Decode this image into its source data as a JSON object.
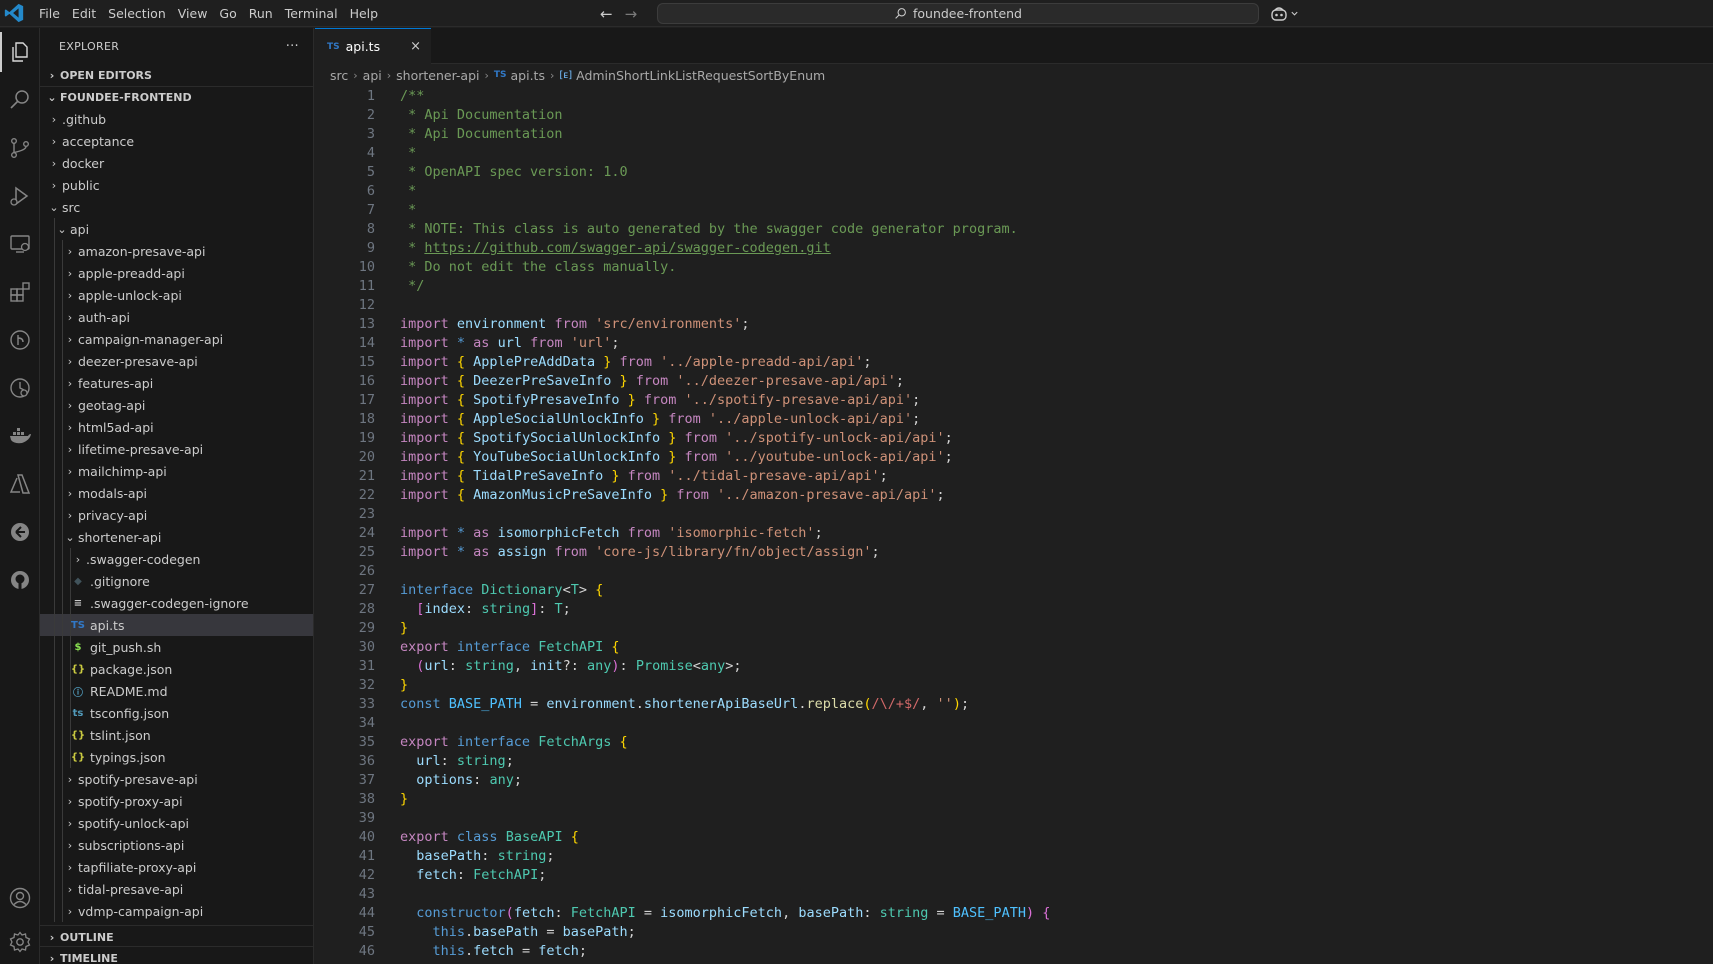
{
  "titlebar": {
    "menu": [
      "File",
      "Edit",
      "Selection",
      "View",
      "Go",
      "Run",
      "Terminal",
      "Help"
    ],
    "search": "foundee-frontend"
  },
  "sidebar": {
    "title": "EXPLORER",
    "more": "···",
    "open_editors": "OPEN EDITORS",
    "project": "FOUNDEE-FRONTEND",
    "outline": "OUTLINE",
    "timeline": "TIMELINE",
    "tree": [
      {
        "label": ".github",
        "depth": 1,
        "kind": "folder",
        "open": false
      },
      {
        "label": "acceptance",
        "depth": 1,
        "kind": "folder",
        "open": false
      },
      {
        "label": "docker",
        "depth": 1,
        "kind": "folder",
        "open": false
      },
      {
        "label": "public",
        "depth": 1,
        "kind": "folder",
        "open": false
      },
      {
        "label": "src",
        "depth": 1,
        "kind": "folder",
        "open": true
      },
      {
        "label": "api",
        "depth": 2,
        "kind": "folder",
        "open": true
      },
      {
        "label": "amazon-presave-api",
        "depth": 3,
        "kind": "folder",
        "open": false
      },
      {
        "label": "apple-preadd-api",
        "depth": 3,
        "kind": "folder",
        "open": false
      },
      {
        "label": "apple-unlock-api",
        "depth": 3,
        "kind": "folder",
        "open": false
      },
      {
        "label": "auth-api",
        "depth": 3,
        "kind": "folder",
        "open": false
      },
      {
        "label": "campaign-manager-api",
        "depth": 3,
        "kind": "folder",
        "open": false
      },
      {
        "label": "deezer-presave-api",
        "depth": 3,
        "kind": "folder",
        "open": false
      },
      {
        "label": "features-api",
        "depth": 3,
        "kind": "folder",
        "open": false
      },
      {
        "label": "geotag-api",
        "depth": 3,
        "kind": "folder",
        "open": false
      },
      {
        "label": "html5ad-api",
        "depth": 3,
        "kind": "folder",
        "open": false
      },
      {
        "label": "lifetime-presave-api",
        "depth": 3,
        "kind": "folder",
        "open": false
      },
      {
        "label": "mailchimp-api",
        "depth": 3,
        "kind": "folder",
        "open": false
      },
      {
        "label": "modals-api",
        "depth": 3,
        "kind": "folder",
        "open": false
      },
      {
        "label": "privacy-api",
        "depth": 3,
        "kind": "folder",
        "open": false
      },
      {
        "label": "shortener-api",
        "depth": 3,
        "kind": "folder",
        "open": true
      },
      {
        "label": ".swagger-codegen",
        "depth": 4,
        "kind": "folder",
        "open": false
      },
      {
        "label": ".gitignore",
        "depth": 4,
        "kind": "file",
        "icon": "◆",
        "color": "#41535b"
      },
      {
        "label": ".swagger-codegen-ignore",
        "depth": 4,
        "kind": "file",
        "icon": "≡",
        "color": "#cccccc"
      },
      {
        "label": "api.ts",
        "depth": 4,
        "kind": "file",
        "icon": "TS",
        "color": "#3178c6",
        "selected": true
      },
      {
        "label": "git_push.sh",
        "depth": 4,
        "kind": "file",
        "icon": "$",
        "color": "#89e051"
      },
      {
        "label": "package.json",
        "depth": 4,
        "kind": "file",
        "icon": "{}",
        "color": "#cbcb41"
      },
      {
        "label": "README.md",
        "depth": 4,
        "kind": "file",
        "icon": "ⓘ",
        "color": "#519aba"
      },
      {
        "label": "tsconfig.json",
        "depth": 4,
        "kind": "file",
        "icon": "ts",
        "color": "#519aba"
      },
      {
        "label": "tslint.json",
        "depth": 4,
        "kind": "file",
        "icon": "{}",
        "color": "#cbcb41"
      },
      {
        "label": "typings.json",
        "depth": 4,
        "kind": "file",
        "icon": "{}",
        "color": "#cbcb41"
      },
      {
        "label": "spotify-presave-api",
        "depth": 3,
        "kind": "folder",
        "open": false
      },
      {
        "label": "spotify-proxy-api",
        "depth": 3,
        "kind": "folder",
        "open": false
      },
      {
        "label": "spotify-unlock-api",
        "depth": 3,
        "kind": "folder",
        "open": false
      },
      {
        "label": "subscriptions-api",
        "depth": 3,
        "kind": "folder",
        "open": false
      },
      {
        "label": "tapfiliate-proxy-api",
        "depth": 3,
        "kind": "folder",
        "open": false
      },
      {
        "label": "tidal-presave-api",
        "depth": 3,
        "kind": "folder",
        "open": false
      },
      {
        "label": "vdmp-campaign-api",
        "depth": 3,
        "kind": "folder",
        "open": false
      }
    ]
  },
  "editor": {
    "tab": {
      "lang": "TS",
      "label": "api.ts",
      "close": "×"
    },
    "breadcrumb": [
      "src",
      "api",
      "shortener-api",
      "api.ts",
      "AdminShortLinkListRequestSortByEnum"
    ],
    "breadcrumb_ts": "TS",
    "breadcrumb_symbol_icon": "[ᴇ]",
    "lines": [
      [
        [
          "cm",
          "/**"
        ]
      ],
      [
        [
          "cm",
          " * Api Documentation"
        ]
      ],
      [
        [
          "cm",
          " * Api Documentation"
        ]
      ],
      [
        [
          "cm",
          " *"
        ]
      ],
      [
        [
          "cm",
          " * OpenAPI spec version: 1.0"
        ]
      ],
      [
        [
          "cm",
          " *"
        ]
      ],
      [
        [
          "cm",
          " *"
        ]
      ],
      [
        [
          "cm",
          " * NOTE: This class is auto generated by the swagger code generator program."
        ]
      ],
      [
        [
          "cm",
          " * "
        ],
        [
          "ln-link",
          "https://github.com/swagger-api/swagger-codegen.git"
        ]
      ],
      [
        [
          "cm",
          " * Do not edit the class manually."
        ]
      ],
      [
        [
          "cm",
          " */"
        ]
      ],
      [],
      [
        [
          "kw",
          "import "
        ],
        [
          "vr",
          "environment"
        ],
        [
          "kw",
          " from "
        ],
        [
          "st",
          "'src/environments'"
        ],
        [
          "op",
          ";"
        ]
      ],
      [
        [
          "kw",
          "import "
        ],
        [
          "kb",
          "*"
        ],
        [
          "kw",
          " as "
        ],
        [
          "vr",
          "url"
        ],
        [
          "kw",
          " from "
        ],
        [
          "st",
          "'url'"
        ],
        [
          "op",
          ";"
        ]
      ],
      [
        [
          "kw",
          "import "
        ],
        [
          "b1",
          "{ "
        ],
        [
          "vr",
          "ApplePreAddData"
        ],
        [
          "b1",
          " }"
        ],
        [
          "kw",
          " from "
        ],
        [
          "st",
          "'../apple-preadd-api/api'"
        ],
        [
          "op",
          ";"
        ]
      ],
      [
        [
          "kw",
          "import "
        ],
        [
          "b1",
          "{ "
        ],
        [
          "vr",
          "DeezerPreSaveInfo"
        ],
        [
          "b1",
          " }"
        ],
        [
          "kw",
          " from "
        ],
        [
          "st",
          "'../deezer-presave-api/api'"
        ],
        [
          "op",
          ";"
        ]
      ],
      [
        [
          "kw",
          "import "
        ],
        [
          "b1",
          "{ "
        ],
        [
          "vr",
          "SpotifyPresaveInfo"
        ],
        [
          "b1",
          " }"
        ],
        [
          "kw",
          " from "
        ],
        [
          "st",
          "'../spotify-presave-api/api'"
        ],
        [
          "op",
          ";"
        ]
      ],
      [
        [
          "kw",
          "import "
        ],
        [
          "b1",
          "{ "
        ],
        [
          "vr",
          "AppleSocialUnlockInfo"
        ],
        [
          "b1",
          " }"
        ],
        [
          "kw",
          " from "
        ],
        [
          "st",
          "'../apple-unlock-api/api'"
        ],
        [
          "op",
          ";"
        ]
      ],
      [
        [
          "kw",
          "import "
        ],
        [
          "b1",
          "{ "
        ],
        [
          "vr",
          "SpotifySocialUnlockInfo"
        ],
        [
          "b1",
          " }"
        ],
        [
          "kw",
          " from "
        ],
        [
          "st",
          "'../spotify-unlock-api/api'"
        ],
        [
          "op",
          ";"
        ]
      ],
      [
        [
          "kw",
          "import "
        ],
        [
          "b1",
          "{ "
        ],
        [
          "vr",
          "YouTubeSocialUnlockInfo"
        ],
        [
          "b1",
          " }"
        ],
        [
          "kw",
          " from "
        ],
        [
          "st",
          "'../youtube-unlock-api/api'"
        ],
        [
          "op",
          ";"
        ]
      ],
      [
        [
          "kw",
          "import "
        ],
        [
          "b1",
          "{ "
        ],
        [
          "vr",
          "TidalPreSaveInfo"
        ],
        [
          "b1",
          " }"
        ],
        [
          "kw",
          " from "
        ],
        [
          "st",
          "'../tidal-presave-api/api'"
        ],
        [
          "op",
          ";"
        ]
      ],
      [
        [
          "kw",
          "import "
        ],
        [
          "b1",
          "{ "
        ],
        [
          "vr",
          "AmazonMusicPreSaveInfo"
        ],
        [
          "b1",
          " }"
        ],
        [
          "kw",
          " from "
        ],
        [
          "st",
          "'../amazon-presave-api/api'"
        ],
        [
          "op",
          ";"
        ]
      ],
      [],
      [
        [
          "kw",
          "import "
        ],
        [
          "kb",
          "*"
        ],
        [
          "kw",
          " as "
        ],
        [
          "vr",
          "isomorphicFetch"
        ],
        [
          "kw",
          " from "
        ],
        [
          "st",
          "'isomorphic-fetch'"
        ],
        [
          "op",
          ";"
        ]
      ],
      [
        [
          "kw",
          "import "
        ],
        [
          "kb",
          "*"
        ],
        [
          "kw",
          " as "
        ],
        [
          "vr",
          "assign"
        ],
        [
          "kw",
          " from "
        ],
        [
          "st",
          "'core-js/library/fn/object/assign'"
        ],
        [
          "op",
          ";"
        ]
      ],
      [],
      [
        [
          "kb",
          "interface "
        ],
        [
          "ty",
          "Dictionary"
        ],
        [
          "op",
          "<"
        ],
        [
          "ty",
          "T"
        ],
        [
          "op",
          "> "
        ],
        [
          "b1",
          "{"
        ]
      ],
      [
        [
          "op",
          "  "
        ],
        [
          "b2",
          "["
        ],
        [
          "vr",
          "index"
        ],
        [
          "op",
          ": "
        ],
        [
          "ty",
          "string"
        ],
        [
          "b2",
          "]"
        ],
        [
          "op",
          ": "
        ],
        [
          "ty",
          "T"
        ],
        [
          "op",
          ";"
        ]
      ],
      [
        [
          "b1",
          "}"
        ]
      ],
      [
        [
          "kw",
          "export "
        ],
        [
          "kb",
          "interface "
        ],
        [
          "ty",
          "FetchAPI"
        ],
        [
          "op",
          " "
        ],
        [
          "b1",
          "{"
        ]
      ],
      [
        [
          "op",
          "  "
        ],
        [
          "b2",
          "("
        ],
        [
          "vr",
          "url"
        ],
        [
          "op",
          ": "
        ],
        [
          "ty",
          "string"
        ],
        [
          "op",
          ", "
        ],
        [
          "vr",
          "init"
        ],
        [
          "op",
          "?: "
        ],
        [
          "ty",
          "any"
        ],
        [
          "b2",
          ")"
        ],
        [
          "op",
          ": "
        ],
        [
          "ty",
          "Promise"
        ],
        [
          "op",
          "<"
        ],
        [
          "ty",
          "any"
        ],
        [
          "op",
          ">;"
        ]
      ],
      [
        [
          "b1",
          "}"
        ]
      ],
      [
        [
          "kb",
          "const "
        ],
        [
          "cn",
          "BASE_PATH"
        ],
        [
          "op",
          " = "
        ],
        [
          "vr",
          "environment"
        ],
        [
          "op",
          "."
        ],
        [
          "vr",
          "shortenerApiBaseUrl"
        ],
        [
          "op",
          "."
        ],
        [
          "fn",
          "replace"
        ],
        [
          "b1",
          "("
        ],
        [
          "rx",
          "/\\/+$/"
        ],
        [
          "op",
          ", "
        ],
        [
          "st",
          "''"
        ],
        [
          "b1",
          ")"
        ],
        [
          "op",
          ";"
        ]
      ],
      [],
      [
        [
          "kw",
          "export "
        ],
        [
          "kb",
          "interface "
        ],
        [
          "ty",
          "FetchArgs"
        ],
        [
          "op",
          " "
        ],
        [
          "b1",
          "{"
        ]
      ],
      [
        [
          "op",
          "  "
        ],
        [
          "vr",
          "url"
        ],
        [
          "op",
          ": "
        ],
        [
          "ty",
          "string"
        ],
        [
          "op",
          ";"
        ]
      ],
      [
        [
          "op",
          "  "
        ],
        [
          "vr",
          "options"
        ],
        [
          "op",
          ": "
        ],
        [
          "ty",
          "any"
        ],
        [
          "op",
          ";"
        ]
      ],
      [
        [
          "b1",
          "}"
        ]
      ],
      [],
      [
        [
          "kw",
          "export "
        ],
        [
          "kb",
          "class "
        ],
        [
          "ty",
          "BaseAPI"
        ],
        [
          "op",
          " "
        ],
        [
          "b1",
          "{"
        ]
      ],
      [
        [
          "op",
          "  "
        ],
        [
          "vr",
          "basePath"
        ],
        [
          "op",
          ": "
        ],
        [
          "ty",
          "string"
        ],
        [
          "op",
          ";"
        ]
      ],
      [
        [
          "op",
          "  "
        ],
        [
          "vr",
          "fetch"
        ],
        [
          "op",
          ": "
        ],
        [
          "ty",
          "FetchAPI"
        ],
        [
          "op",
          ";"
        ]
      ],
      [],
      [
        [
          "op",
          "  "
        ],
        [
          "kb",
          "constructor"
        ],
        [
          "b2",
          "("
        ],
        [
          "vr",
          "fetch"
        ],
        [
          "op",
          ": "
        ],
        [
          "ty",
          "FetchAPI"
        ],
        [
          "op",
          " = "
        ],
        [
          "vr",
          "isomorphicFetch"
        ],
        [
          "op",
          ", "
        ],
        [
          "vr",
          "basePath"
        ],
        [
          "op",
          ": "
        ],
        [
          "ty",
          "string"
        ],
        [
          "op",
          " = "
        ],
        [
          "cn",
          "BASE_PATH"
        ],
        [
          "b2",
          ")"
        ],
        [
          "op",
          " "
        ],
        [
          "b2",
          "{"
        ]
      ],
      [
        [
          "op",
          "    "
        ],
        [
          "kb",
          "this"
        ],
        [
          "op",
          "."
        ],
        [
          "vr",
          "basePath"
        ],
        [
          "op",
          " = "
        ],
        [
          "vr",
          "basePath"
        ],
        [
          "op",
          ";"
        ]
      ],
      [
        [
          "op",
          "    "
        ],
        [
          "kb",
          "this"
        ],
        [
          "op",
          "."
        ],
        [
          "vr",
          "fetch"
        ],
        [
          "op",
          " = "
        ],
        [
          "vr",
          "fetch"
        ],
        [
          "op",
          ";"
        ]
      ]
    ]
  }
}
